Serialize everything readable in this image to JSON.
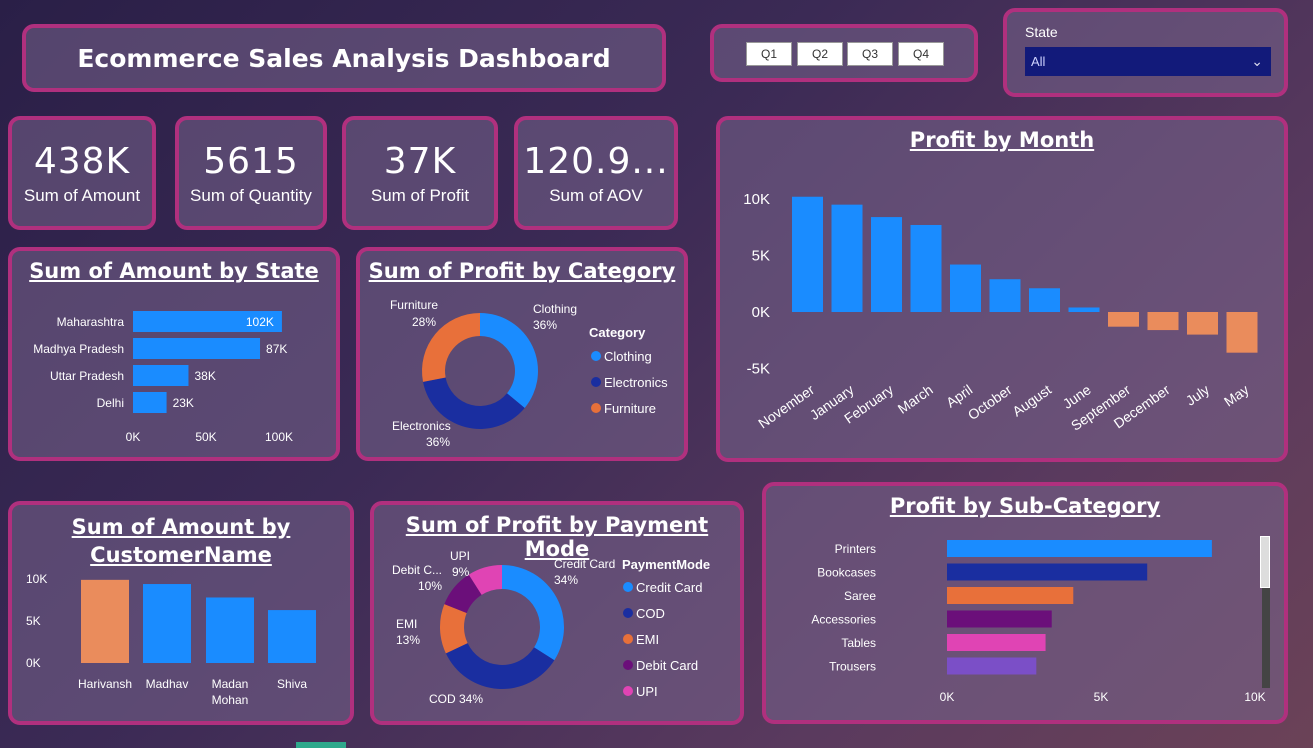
{
  "header": {
    "title": "Ecommerce Sales Analysis Dashboard"
  },
  "quarters": [
    "Q1",
    "Q2",
    "Q3",
    "Q4"
  ],
  "state_filter": {
    "label": "State",
    "value": "All"
  },
  "kpis": [
    {
      "value": "438K",
      "label": "Sum of Amount"
    },
    {
      "value": "5615",
      "label": "Sum of Quantity"
    },
    {
      "value": "37K",
      "label": "Sum of Profit"
    },
    {
      "value": "120.9...",
      "label": "Sum of AOV"
    }
  ],
  "colors": {
    "blue": "#1a8cff",
    "navy": "#1a2ea0",
    "orange": "#e8703a",
    "purple": "#6b0f7a",
    "pink": "#e044b4",
    "salmon": "#ea8c5c",
    "violet": "#7b4fc7"
  },
  "chart_data": [
    {
      "id": "amount_by_state",
      "type": "bar",
      "orientation": "horizontal",
      "title": "Sum of Amount by State",
      "categories": [
        "Maharashtra",
        "Madhya Pradesh",
        "Uttar Pradesh",
        "Delhi"
      ],
      "values": [
        102,
        87,
        38,
        23
      ],
      "data_labels": [
        "102K",
        "87K",
        "38K",
        "23K"
      ],
      "xticks": [
        "0K",
        "50K",
        "100K"
      ],
      "xlim": [
        0,
        100
      ]
    },
    {
      "id": "profit_by_category",
      "type": "pie",
      "title": "Sum of Profit by Category",
      "legend_title": "Category",
      "categories": [
        "Clothing",
        "Electronics",
        "Furniture"
      ],
      "values": [
        36,
        36,
        28
      ],
      "slice_labels": [
        {
          "name": "Clothing",
          "pct": "36%"
        },
        {
          "name": "Electronics",
          "pct": "36%"
        },
        {
          "name": "Furniture",
          "pct": "28%"
        }
      ]
    },
    {
      "id": "profit_by_month",
      "type": "bar",
      "title": "Profit by Month",
      "categories": [
        "November",
        "January",
        "February",
        "March",
        "April",
        "October",
        "August",
        "June",
        "September",
        "December",
        "July",
        "May"
      ],
      "values": [
        10200,
        9500,
        8400,
        7700,
        4200,
        2900,
        2100,
        400,
        -1300,
        -1600,
        -2000,
        -3600
      ],
      "yticks": [
        "10K",
        "5K",
        "0K",
        "-5K"
      ],
      "ylim": [
        -5000,
        10000
      ]
    },
    {
      "id": "amount_by_customer",
      "type": "bar",
      "title": "Sum of Amount by CustomerName",
      "title_lines": [
        "Sum of Amount by",
        "CustomerName"
      ],
      "categories": [
        "Harivansh",
        "Madhav",
        "Madan Mohan",
        "Shiva"
      ],
      "category_lines": [
        [
          "Harivansh"
        ],
        [
          "Madhav"
        ],
        [
          "Madan",
          "Mohan"
        ],
        [
          "Shiva"
        ]
      ],
      "values": [
        9900,
        9400,
        7800,
        6300
      ],
      "yticks": [
        "10K",
        "5K",
        "0K"
      ],
      "ylim": [
        0,
        10000
      ]
    },
    {
      "id": "profit_by_payment",
      "type": "pie",
      "title": "Sum of Profit by Payment Mode",
      "legend_title": "PaymentMode",
      "categories": [
        "Credit Card",
        "COD",
        "EMI",
        "Debit Card",
        "UPI"
      ],
      "values": [
        34,
        34,
        13,
        10,
        9
      ],
      "slice_labels": [
        {
          "name": "Credit Card",
          "pct": "34%"
        },
        {
          "name": "COD",
          "pct": "34%"
        },
        {
          "name": "EMI",
          "pct": "13%"
        },
        {
          "name": "Debit C...",
          "pct": "10%"
        },
        {
          "name": "UPI",
          "pct": "9%"
        }
      ]
    },
    {
      "id": "profit_by_subcategory",
      "type": "bar",
      "orientation": "horizontal",
      "title": "Profit by Sub-Category",
      "categories": [
        "Printers",
        "Bookcases",
        "Saree",
        "Accessories",
        "Tables",
        "Trousers"
      ],
      "values": [
        8600,
        6500,
        4100,
        3400,
        3200,
        2900
      ],
      "xticks": [
        "0K",
        "5K",
        "10K"
      ],
      "xlim": [
        0,
        10000
      ]
    }
  ]
}
